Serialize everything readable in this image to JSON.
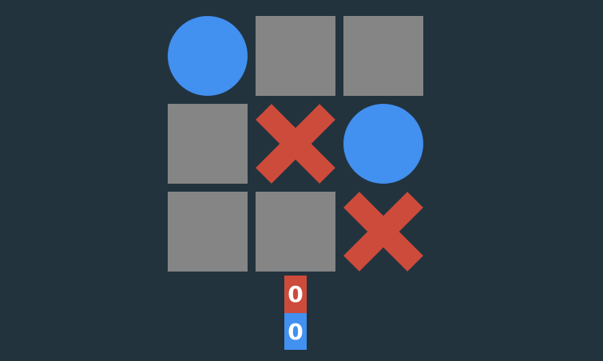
{
  "board": [
    "O",
    "",
    "",
    "",
    "X",
    "O",
    "",
    "",
    "X"
  ],
  "colors": {
    "x": "#cd4b3b",
    "o": "#4290f0",
    "empty": "#858585",
    "background": "#22333d"
  },
  "scores": {
    "x": "0",
    "o": "0"
  }
}
